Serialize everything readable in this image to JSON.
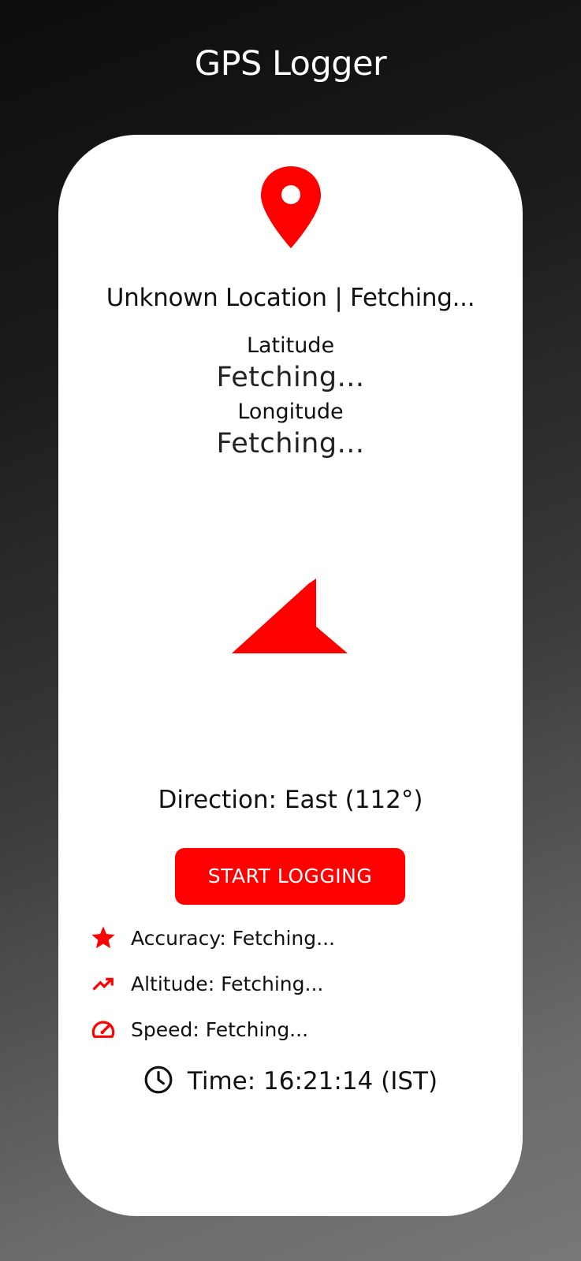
{
  "app": {
    "title": "GPS Logger"
  },
  "location": {
    "title": "Unknown Location | Fetching...",
    "latitude_label": "Latitude",
    "latitude_value": "Fetching...",
    "longitude_label": "Longitude",
    "longitude_value": "Fetching..."
  },
  "direction": {
    "text": "Direction: East (112°)"
  },
  "actions": {
    "start_label": "START LOGGING"
  },
  "stats": {
    "accuracy": "Accuracy: Fetching...",
    "altitude": "Altitude: Fetching...",
    "speed": "Speed: Fetching..."
  },
  "time": {
    "text": "Time: 16:21:14 (IST)"
  },
  "icons": {
    "pin": "location-pin-icon",
    "arrow": "direction-arrow-icon",
    "accuracy": "star-icon",
    "altitude": "trending-up-icon",
    "speed": "speedometer-icon",
    "time": "clock-icon"
  },
  "colors": {
    "accent": "#ff0000",
    "card": "#ffffff",
    "text": "#111111"
  }
}
